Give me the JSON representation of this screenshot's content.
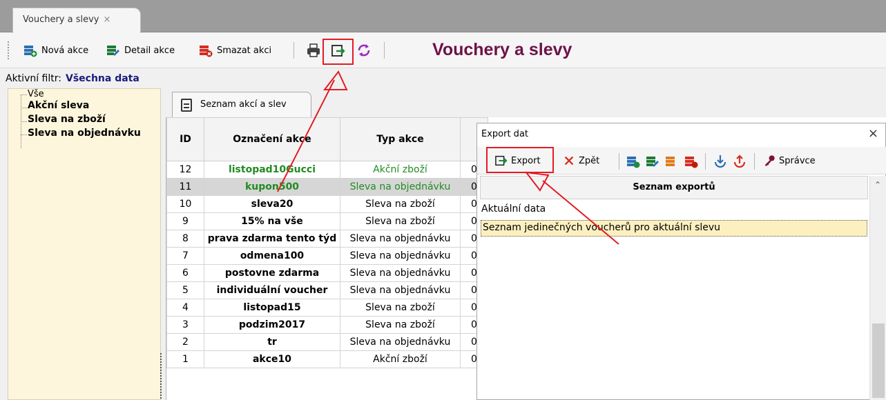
{
  "doc_tab": {
    "label": "Vouchery a slevy",
    "close": "×"
  },
  "toolbar": {
    "new_label": "Nová akce",
    "detail_label": "Detail akce",
    "delete_label": "Smazat akci",
    "title": "Vouchery a slevy"
  },
  "filter": {
    "label": "Aktivní filtr:",
    "value": "Všechna data"
  },
  "tree": {
    "items": [
      "Vše",
      "Akční sleva",
      "Sleva na zboží",
      "Sleva na objednávku"
    ]
  },
  "inner_tab": {
    "label": "Seznam akcí a slev"
  },
  "grid": {
    "headers": {
      "id": "ID",
      "name": "Označení akce",
      "type": "Typ akce"
    },
    "rows": [
      {
        "id": "12",
        "name": "listopad10Gucci",
        "type": "Akční zboží",
        "rest": "0"
      },
      {
        "id": "11",
        "name": "kupon500",
        "type": "Sleva na objednávku",
        "rest": "0"
      },
      {
        "id": "10",
        "name": "sleva20",
        "type": "Sleva na zboží",
        "rest": "0"
      },
      {
        "id": "9",
        "name": "15% na vše",
        "type": "Sleva na zboží",
        "rest": "0"
      },
      {
        "id": "8",
        "name": "prava zdarma tento týd",
        "type": "Sleva na objednávku",
        "rest": "0"
      },
      {
        "id": "7",
        "name": "odmena100",
        "type": "Sleva na objednávku",
        "rest": "0"
      },
      {
        "id": "6",
        "name": "postovne zdarma",
        "type": "Sleva na objednávku",
        "rest": "0"
      },
      {
        "id": "5",
        "name": "individuální voucher",
        "type": "Sleva na objednávku",
        "rest": "0"
      },
      {
        "id": "4",
        "name": "listopad15",
        "type": "Sleva na zboží",
        "rest": "0"
      },
      {
        "id": "3",
        "name": "podzim2017",
        "type": "Sleva na zboží",
        "rest": "0"
      },
      {
        "id": "2",
        "name": "tr",
        "type": "Sleva na objednávku",
        "rest": "0"
      },
      {
        "id": "1",
        "name": "akce10",
        "type": "Akční zboží",
        "rest": "0"
      }
    ]
  },
  "dialog": {
    "title": "Export dat",
    "close": "×",
    "export_label": "Export",
    "back_label": "Zpět",
    "admin_label": "Správce",
    "list_header": "Seznam exportů",
    "items": [
      "Aktuální data",
      "Seznam jedinečných voucherů pro aktuální slevu"
    ]
  },
  "colors": {
    "title": "#6d1248",
    "filter_value": "#1a1a7e",
    "green_row": "#228b22",
    "highlight": "#e31b23"
  }
}
